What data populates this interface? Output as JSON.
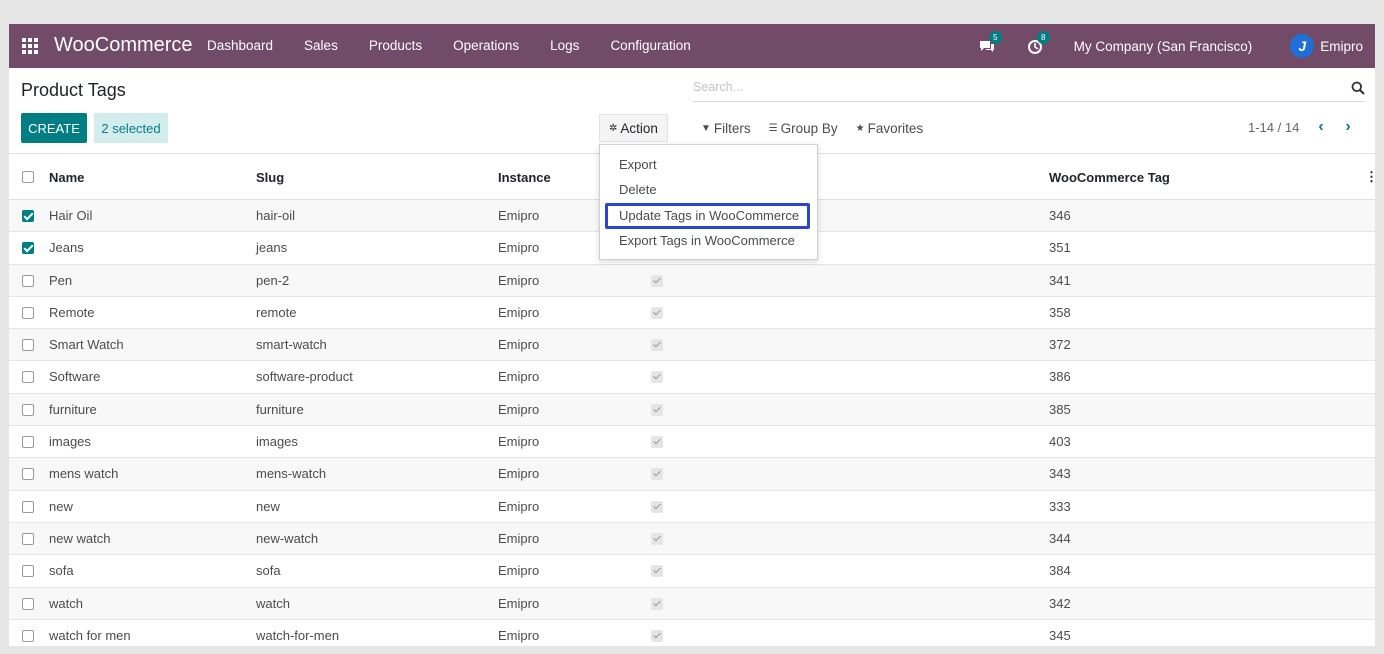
{
  "navbar": {
    "brand": "WooCommerce",
    "menu": [
      "Dashboard",
      "Sales",
      "Products",
      "Operations",
      "Logs",
      "Configuration"
    ],
    "messages_count": "5",
    "activities_count": "8",
    "company": "My Company (San Francisco)",
    "user": "Emipro",
    "color": "#714b67"
  },
  "page": {
    "title": "Product Tags",
    "create_label": "CREATE",
    "selected_label": "2 selected",
    "action_label": "Action",
    "search_placeholder": "Search...",
    "filters_label": "Filters",
    "groupby_label": "Group By",
    "favorites_label": "Favorites",
    "pager": "1-14 / 14",
    "accent": "#017e84"
  },
  "action_menu": {
    "items": [
      "Export",
      "Delete",
      "Update Tags in WooCommerce",
      "Export Tags in WooCommerce"
    ],
    "highlighted": "Update Tags in WooCommerce"
  },
  "table": {
    "headers": [
      "Name",
      "Slug",
      "Instance",
      "WooCommerce Tag"
    ],
    "rows": [
      {
        "name": "Hair Oil",
        "slug": "hair-oil",
        "instance": "Emipro",
        "tag": "346",
        "selected": true
      },
      {
        "name": "Jeans",
        "slug": "jeans",
        "instance": "Emipro",
        "tag": "351",
        "selected": true
      },
      {
        "name": "Pen",
        "slug": "pen-2",
        "instance": "Emipro",
        "tag": "341",
        "selected": false
      },
      {
        "name": "Remote",
        "slug": "remote",
        "instance": "Emipro",
        "tag": "358",
        "selected": false
      },
      {
        "name": "Smart Watch",
        "slug": "smart-watch",
        "instance": "Emipro",
        "tag": "372",
        "selected": false
      },
      {
        "name": "Software",
        "slug": "software-product",
        "instance": "Emipro",
        "tag": "386",
        "selected": false
      },
      {
        "name": "furniture",
        "slug": "furniture",
        "instance": "Emipro",
        "tag": "385",
        "selected": false
      },
      {
        "name": "images",
        "slug": "images",
        "instance": "Emipro",
        "tag": "403",
        "selected": false
      },
      {
        "name": "mens watch",
        "slug": "mens-watch",
        "instance": "Emipro",
        "tag": "343",
        "selected": false
      },
      {
        "name": "new",
        "slug": "new",
        "instance": "Emipro",
        "tag": "333",
        "selected": false
      },
      {
        "name": "new watch",
        "slug": "new-watch",
        "instance": "Emipro",
        "tag": "344",
        "selected": false
      },
      {
        "name": "sofa",
        "slug": "sofa",
        "instance": "Emipro",
        "tag": "384",
        "selected": false
      },
      {
        "name": "watch",
        "slug": "watch",
        "instance": "Emipro",
        "tag": "342",
        "selected": false
      },
      {
        "name": "watch for men",
        "slug": "watch-for-men",
        "instance": "Emipro",
        "tag": "345",
        "selected": false
      }
    ]
  }
}
